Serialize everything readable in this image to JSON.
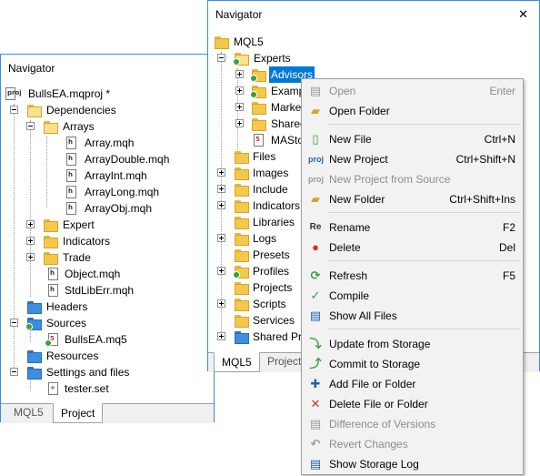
{
  "colors": {
    "accent": "#0078d7",
    "window_border": "#3c8dd8",
    "folder": "#f5c84a",
    "folder_blue": "#3b8ee0",
    "menu_bg": "#f2f2f2"
  },
  "left_window": {
    "title": "Navigator",
    "tree": [
      {
        "label": "BullsEA.mqproj *",
        "icon": "project-file-icon"
      },
      {
        "label": "Dependencies",
        "icon": "folder-open-icon"
      },
      {
        "label": "Arrays",
        "icon": "folder-open-icon"
      },
      {
        "label": "Array.mqh",
        "icon": "header-file-icon"
      },
      {
        "label": "ArrayDouble.mqh",
        "icon": "header-file-icon"
      },
      {
        "label": "ArrayInt.mqh",
        "icon": "header-file-icon"
      },
      {
        "label": "ArrayLong.mqh",
        "icon": "header-file-icon"
      },
      {
        "label": "ArrayObj.mqh",
        "icon": "header-file-icon"
      },
      {
        "label": "Expert",
        "icon": "folder-icon"
      },
      {
        "label": "Indicators",
        "icon": "folder-icon"
      },
      {
        "label": "Trade",
        "icon": "folder-icon"
      },
      {
        "label": "Object.mqh",
        "icon": "header-file-icon"
      },
      {
        "label": "StdLibErr.mqh",
        "icon": "header-file-icon"
      },
      {
        "label": "Headers",
        "icon": "folder-blue-icon"
      },
      {
        "label": "Sources",
        "icon": "folder-storage-icon"
      },
      {
        "label": "BullsEA.mq5",
        "icon": "source-file-icon"
      },
      {
        "label": "Resources",
        "icon": "folder-blue-icon"
      },
      {
        "label": "Settings and files",
        "icon": "folder-settings-icon"
      },
      {
        "label": "tester.set",
        "icon": "settings-file-icon"
      }
    ],
    "tabs": [
      {
        "label": "MQL5"
      },
      {
        "label": "Project"
      }
    ]
  },
  "right_window": {
    "title": "Navigator",
    "close_glyph": "✕",
    "tree": [
      {
        "label": "MQL5",
        "icon": "mql5-root-icon"
      },
      {
        "label": "Experts",
        "icon": "folder-storage-icon"
      },
      {
        "label": "Advisors",
        "icon": "folder-storage-icon"
      },
      {
        "label": "Examp",
        "icon": "folder-storage-icon"
      },
      {
        "label": "Marke",
        "icon": "folder-icon"
      },
      {
        "label": "Shared",
        "icon": "folder-icon"
      },
      {
        "label": "MASto",
        "icon": "source-file-icon"
      },
      {
        "label": "Files",
        "icon": "folder-icon"
      },
      {
        "label": "Images",
        "icon": "folder-icon"
      },
      {
        "label": "Include",
        "icon": "folder-icon"
      },
      {
        "label": "Indicators",
        "icon": "folder-icon"
      },
      {
        "label": "Libraries",
        "icon": "folder-icon"
      },
      {
        "label": "Logs",
        "icon": "folder-icon"
      },
      {
        "label": "Presets",
        "icon": "folder-icon"
      },
      {
        "label": "Profiles",
        "icon": "folder-storage-icon"
      },
      {
        "label": "Projects",
        "icon": "folder-icon"
      },
      {
        "label": "Scripts",
        "icon": "folder-icon"
      },
      {
        "label": "Services",
        "icon": "folder-icon"
      },
      {
        "label": "Shared Pro",
        "icon": "folder-blue-icon"
      }
    ],
    "tabs": [
      {
        "label": "MQL5"
      },
      {
        "label": "Project"
      }
    ]
  },
  "context_menu": {
    "items": [
      {
        "label": "Open",
        "shortcut": "Enter",
        "icon": "open-icon",
        "disabled": true
      },
      {
        "label": "Open Folder",
        "shortcut": "",
        "icon": "open-folder-icon",
        "disabled": false
      },
      {
        "label": "New File",
        "shortcut": "Ctrl+N",
        "icon": "new-file-icon",
        "disabled": false
      },
      {
        "label": "New Project",
        "shortcut": "Ctrl+Shift+N",
        "icon": "new-project-icon",
        "disabled": false
      },
      {
        "label": "New Project from Source",
        "shortcut": "",
        "icon": "new-project-source-icon",
        "disabled": true
      },
      {
        "label": "New Folder",
        "shortcut": "Ctrl+Shift+Ins",
        "icon": "new-folder-icon",
        "disabled": false
      },
      {
        "label": "Rename",
        "shortcut": "F2",
        "icon": "rename-icon",
        "disabled": false
      },
      {
        "label": "Delete",
        "shortcut": "Del",
        "icon": "delete-icon",
        "disabled": false
      },
      {
        "label": "Refresh",
        "shortcut": "F5",
        "icon": "refresh-icon",
        "disabled": false
      },
      {
        "label": "Compile",
        "shortcut": "",
        "icon": "compile-icon",
        "disabled": false
      },
      {
        "label": "Show All Files",
        "shortcut": "",
        "icon": "show-files-icon",
        "disabled": false
      },
      {
        "label": "Update from Storage",
        "shortcut": "",
        "icon": "update-storage-icon",
        "disabled": false
      },
      {
        "label": "Commit to Storage",
        "shortcut": "",
        "icon": "commit-storage-icon",
        "disabled": false
      },
      {
        "label": "Add File or Folder",
        "shortcut": "",
        "icon": "add-icon",
        "disabled": false
      },
      {
        "label": "Delete File or Folder",
        "shortcut": "",
        "icon": "remove-icon",
        "disabled": false
      },
      {
        "label": "Difference of Versions",
        "shortcut": "",
        "icon": "diff-icon",
        "disabled": true
      },
      {
        "label": "Revert Changes",
        "shortcut": "",
        "icon": "revert-icon",
        "disabled": true
      },
      {
        "label": "Show Storage Log",
        "shortcut": "",
        "icon": "storage-log-icon",
        "disabled": false
      }
    ]
  }
}
